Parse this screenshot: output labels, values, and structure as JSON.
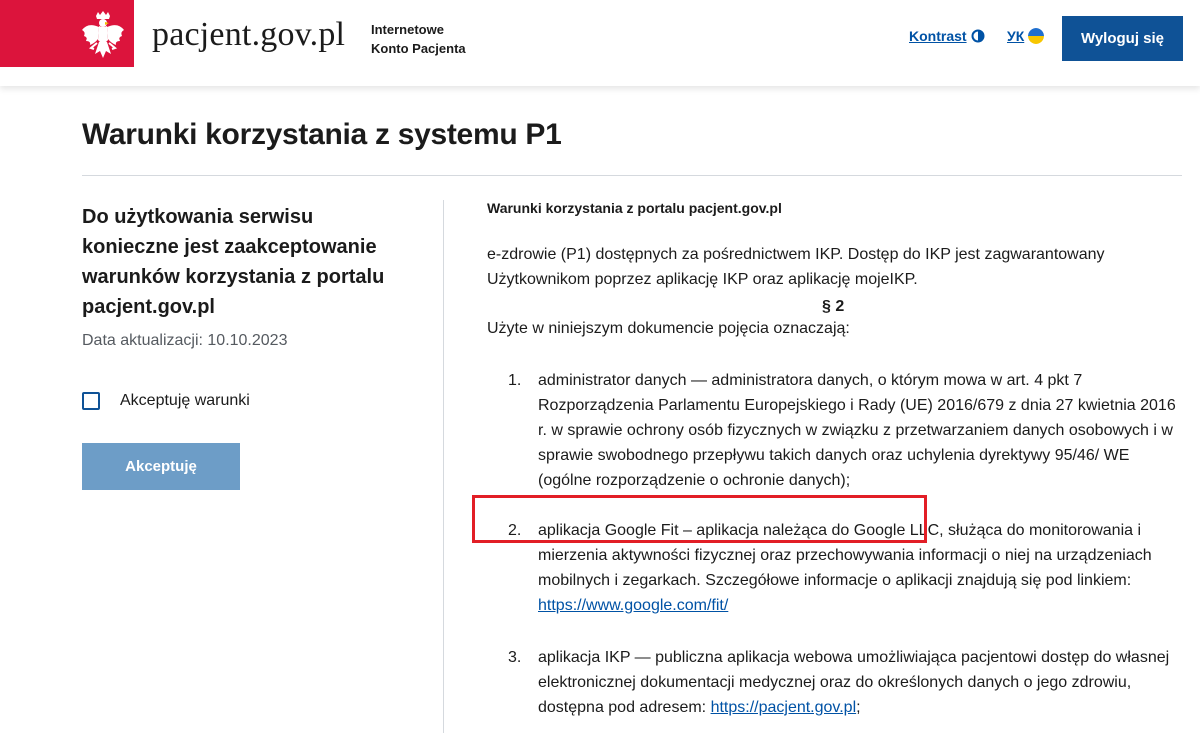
{
  "header": {
    "site_name": "pacjent.gov.pl",
    "site_sub_line1": "Internetowe",
    "site_sub_line2": "Konto Pacjenta",
    "kontrast_label": "Kontrast",
    "lang_label": "УК",
    "logout_label": "Wyloguj się",
    "icons": {
      "emblem": "white-eagle-emblem",
      "contrast": "contrast-icon",
      "language": "ukraine-flag-icon"
    },
    "colors": {
      "flag_red": "#dc143c",
      "primary": "#0f5296",
      "link": "#0052a5"
    }
  },
  "page": {
    "title": "Warunki korzystania z systemu P1"
  },
  "left": {
    "heading": "Do użytkowania serwisu konieczne jest zaakceptowanie warunków korzystania z portalu pacjent.gov.pl",
    "update_date": "Data aktualizacji: 10.10.2023",
    "checkbox_label": "Akceptuję warunki",
    "checkbox_checked": false,
    "accept_button": "Akceptuję"
  },
  "document": {
    "title": "Warunki korzystania z portalu pacjent.gov.pl",
    "paragraph": "e-zdrowie (P1) dostępnych za pośrednictwem IKP. Dostęp do IKP jest zagwarantowany Użytkownikom poprzez aplikację IKP oraz aplikację mojeIKP.",
    "section": "§ 2",
    "intro": "Użyte w niniejszym dokumencie pojęcia oznaczają:",
    "definitions": [
      {
        "num": "1.",
        "text": "administrator danych — administratora danych, o którym mowa w art. 4 pkt 7 Rozporządzenia Parlamentu Europejskiego i Rady (UE) 2016/679 z dnia 27 kwietnia 2016 r. w sprawie ochrony osób fizycznych w związku z przetwarzaniem danych osobowych i w sprawie swobodnego przepływu takich danych oraz uchylenia dyrektywy 95/46/ WE (ogólne rozporządzenie o ochronie danych);"
      },
      {
        "num": "2.",
        "text": "aplikacja Google Fit – aplikacja należąca do Google LLC, służąca do monitorowania i mierzenia aktywności fizycznej oraz przechowywania informacji o niej na urządzeniach mobilnych i zegarkach. Szczegółowe informacje o aplikacji znajdują się pod linkiem: ",
        "link": "https://www.google.com/fit/"
      },
      {
        "num": "3.",
        "text": "aplikacja IKP — publiczna aplikacja webowa umożliwiająca pacjentowi dostęp do własnej elektronicznej dokumentacji medycznej oraz do określonych danych o jego zdrowiu, dostępna pod adresem: ",
        "link": "https://pacjent.gov.pl",
        "suffix": ";"
      }
    ],
    "highlight_color": "#e21e26"
  }
}
